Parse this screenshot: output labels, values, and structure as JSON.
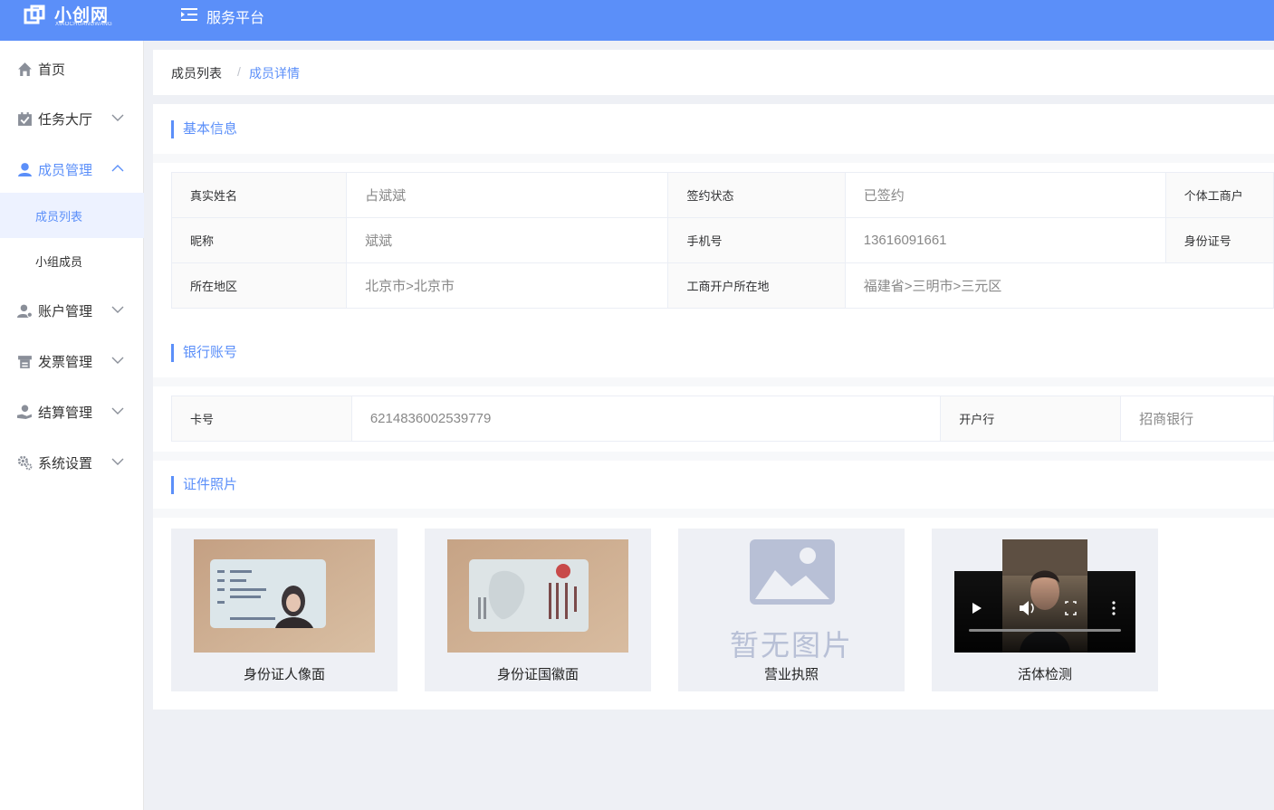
{
  "header": {
    "logo_cn": "小创网",
    "logo_en": "XIAOCHUANGWANG",
    "platform": "服务平台"
  },
  "sidebar": {
    "items": [
      {
        "label": "首页",
        "icon": "home-icon"
      },
      {
        "label": "任务大厅",
        "icon": "calendar-check-icon"
      },
      {
        "label": "成员管理",
        "icon": "user-icon"
      },
      {
        "label": "账户管理",
        "icon": "user-cog-icon"
      },
      {
        "label": "发票管理",
        "icon": "invoice-icon"
      },
      {
        "label": "结算管理",
        "icon": "hand-coin-icon"
      },
      {
        "label": "系统设置",
        "icon": "gears-icon"
      }
    ],
    "sub_items": [
      {
        "label": "成员列表"
      },
      {
        "label": "小组成员"
      }
    ]
  },
  "breadcrumb": {
    "list": "成员列表",
    "sep": "/",
    "detail": "成员详情"
  },
  "basic": {
    "title": "基本信息",
    "rows": [
      {
        "l1": "真实姓名",
        "v1": "占斌斌",
        "l2": "签约状态",
        "v2": "已签约",
        "l3": "个体工商户"
      },
      {
        "l1": "昵称",
        "v1": "斌斌",
        "l2": "手机号",
        "v2": "13616091661",
        "l3": "身份证号"
      },
      {
        "l1": "所在地区",
        "v1": "北京市>北京市",
        "l2": "工商开户所在地",
        "v2": "福建省>三明市>三元区"
      }
    ]
  },
  "bank": {
    "title": "银行账号",
    "card_label": "卡号",
    "card_value": "6214836002539779",
    "bank_label": "开户行",
    "bank_value": "招商银行"
  },
  "photos": {
    "title": "证件照片",
    "items": [
      {
        "caption": "身份证人像面"
      },
      {
        "caption": "身份证国徽面"
      },
      {
        "caption": "营业执照",
        "placeholder": "暂无图片"
      },
      {
        "caption": "活体检测"
      }
    ]
  }
}
